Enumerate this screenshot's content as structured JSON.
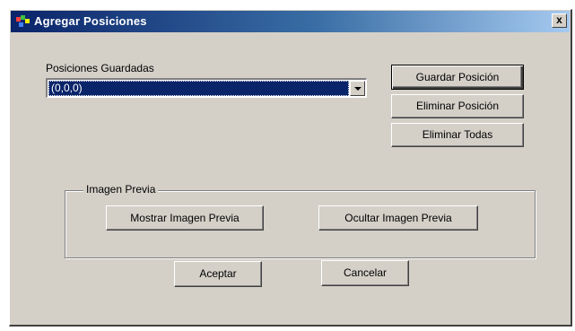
{
  "window": {
    "title": "Agregar Posiciones",
    "close_label": "x"
  },
  "positions": {
    "label": "Posiciones Guardadas",
    "selected": "(0,0,0)"
  },
  "actions": {
    "save": "Guardar Posición",
    "delete": "Eliminar Posición",
    "delete_all": "Eliminar Todas"
  },
  "preview": {
    "group_label": "Imagen Previa",
    "show": "Mostrar Imagen Previa",
    "hide": "Ocultar Imagen Previa"
  },
  "dialog": {
    "accept": "Aceptar",
    "cancel": "Cancelar"
  },
  "colors": {
    "titlebar_start": "#0a246a",
    "titlebar_end": "#a6caf0",
    "face": "#d4d0c8",
    "selection": "#0a246a"
  },
  "icons": {
    "app": "app-icon",
    "close": "close-icon",
    "dropdown": "chevron-down-icon"
  }
}
